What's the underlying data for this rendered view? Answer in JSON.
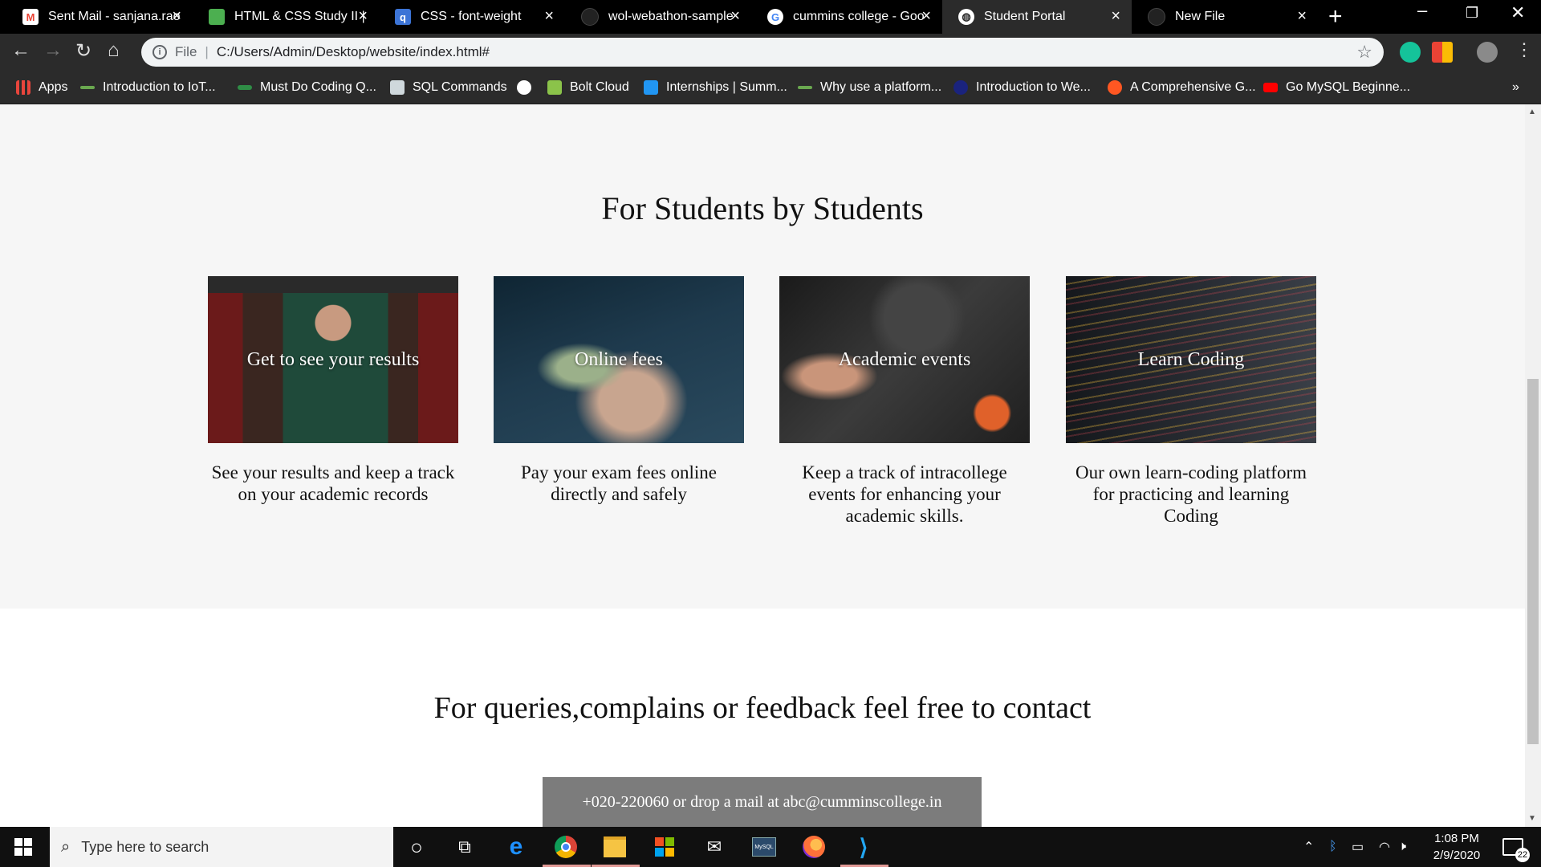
{
  "browser": {
    "tabs": [
      {
        "title": "Sent Mail - sanjana.rao",
        "icon": "gmail-icon",
        "icon_color": "#ea4335",
        "active": false
      },
      {
        "title": "HTML & CSS Study II | I",
        "icon": "course-icon",
        "icon_color": "#4caf50",
        "active": false
      },
      {
        "title": "CSS - font-weight",
        "icon": "css-doc-icon",
        "icon_color": "#3c74d6",
        "active": false
      },
      {
        "title": "wol-webathon-sample",
        "icon": "github-icon",
        "icon_color": "#333333",
        "active": false
      },
      {
        "title": "cummins college - Goo",
        "icon": "google-icon",
        "icon_color": "#ffffff",
        "active": false
      },
      {
        "title": "Student Portal",
        "icon": "globe-icon",
        "icon_color": "#ffffff",
        "active": true
      },
      {
        "title": "New File",
        "icon": "github-icon",
        "icon_color": "#333333",
        "active": false
      }
    ],
    "address": {
      "scheme_label": "File",
      "url": "C:/Users/Admin/Desktop/website/index.html#"
    },
    "bookmarks": [
      {
        "label": "Apps",
        "icon": "apps-grid-icon",
        "color": "#e8453c"
      },
      {
        "label": "Introduction to IoT...",
        "icon": "nptel-icon",
        "color": "#6aa84f"
      },
      {
        "label": "Must Do Coding Q...",
        "icon": "gfg-icon",
        "color": "#2f8d46"
      },
      {
        "label": "SQL Commands",
        "icon": "page-icon",
        "color": "#cfd8dc"
      },
      {
        "label": "",
        "icon": "globe-icon",
        "color": "#ffffff"
      },
      {
        "label": "Bolt Cloud",
        "icon": "bolt-icon",
        "color": "#8bc34a"
      },
      {
        "label": "Internships | Summ...",
        "icon": "internshala-icon",
        "color": "#2196f3"
      },
      {
        "label": "Why use a platform...",
        "icon": "nptel-icon",
        "color": "#6aa84f"
      },
      {
        "label": "Introduction to We...",
        "icon": "dot-icon",
        "color": "#1a237e"
      },
      {
        "label": "A Comprehensive G...",
        "icon": "chrome-icon",
        "color": "#ff5722"
      },
      {
        "label": "Go MySQL Beginne...",
        "icon": "youtube-icon",
        "color": "#ff0000"
      }
    ],
    "bookmarks_overflow": "»"
  },
  "page": {
    "features_heading": "For Students by Students",
    "cards": [
      {
        "image_label": "Get to see your results",
        "image_alt": "graduate-reading-book-image",
        "desc": "See your results and keep a track on your academic records",
        "tint": "#3a2a26"
      },
      {
        "image_label": "Online fees",
        "image_alt": "hands-counting-money-image",
        "desc": "Pay your exam fees online directly and safely",
        "tint": "#1e3140"
      },
      {
        "image_label": "Academic events",
        "image_alt": "circuit-board-soldering-image",
        "desc": "Keep a track of intracollege events for enhancing your academic skills.",
        "tint": "#2a2a2a"
      },
      {
        "image_label": "Learn Coding",
        "image_alt": "code-on-screen-image",
        "desc": "Our own learn-coding platform for practicing and learning Coding",
        "tint": "#1c1f24"
      }
    ],
    "contact_heading": "For queries,complains or feedback feel free to contact",
    "contact_info": "+020-220060 or drop a mail at abc@cumminscollege.in"
  },
  "taskbar": {
    "search_placeholder": "Type here to search",
    "time": "1:08 PM",
    "date": "2/9/2020",
    "notification_count": "22",
    "mysql_label": "MySQL"
  }
}
